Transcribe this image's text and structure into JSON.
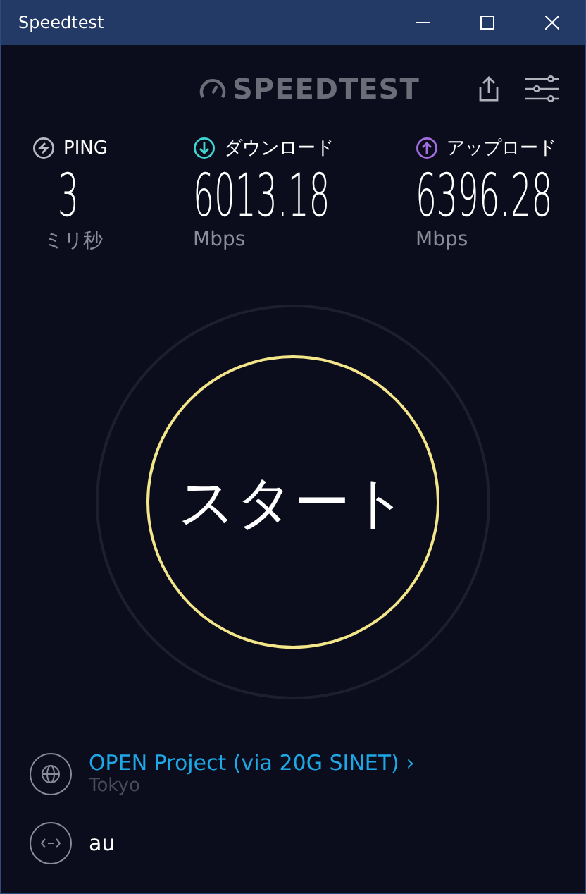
{
  "window": {
    "title": "Speedtest"
  },
  "logo": {
    "text": "SPEEDTEST"
  },
  "metrics": [
    {
      "kind": "ping",
      "label": "PING",
      "value": "3",
      "unit": "ミリ秒"
    },
    {
      "kind": "download",
      "label": "ダウンロード",
      "value": "6013.18",
      "unit": "Mbps"
    },
    {
      "kind": "upload",
      "label": "アップロード",
      "value": "6396.28",
      "unit": "Mbps"
    }
  ],
  "start_button": {
    "label": "スタート"
  },
  "server": {
    "name": "OPEN Project (via 20G SINET)",
    "chevron": "›",
    "location": "Tokyo"
  },
  "provider": {
    "name": "au"
  }
}
